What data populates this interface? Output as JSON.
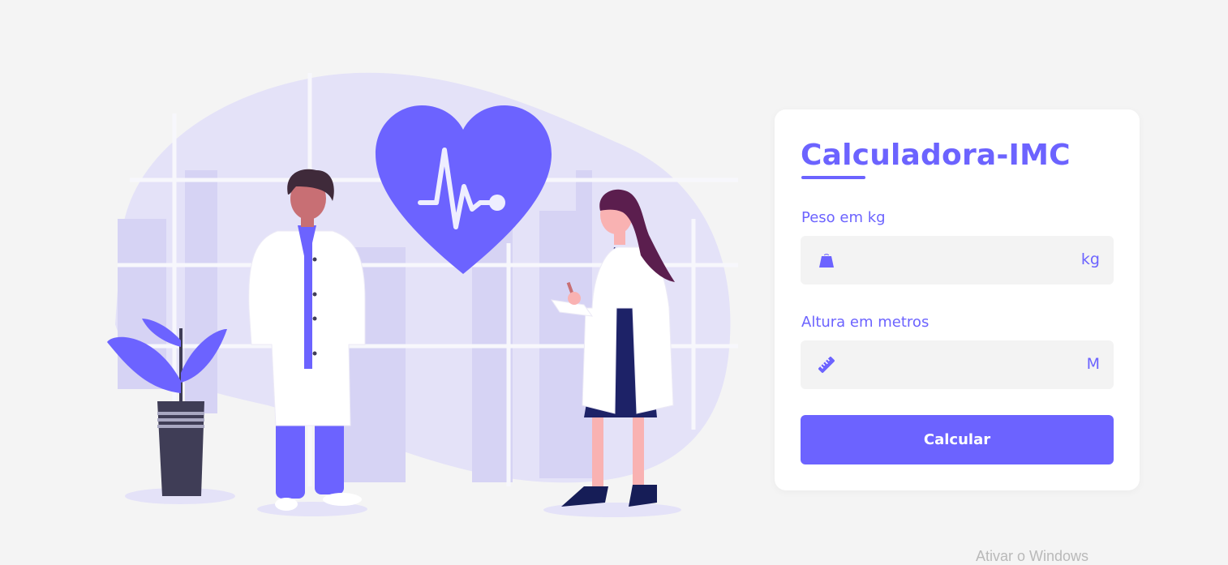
{
  "card": {
    "title": "Calculadora-IMC",
    "weight": {
      "label": "Peso em kg",
      "value": "",
      "unit": "kg",
      "icon": "weight-icon"
    },
    "height": {
      "label": "Altura em metros",
      "value": "",
      "unit": "M",
      "icon": "ruler-icon"
    },
    "button_label": "Calcular"
  },
  "illustration": {
    "icon": "doctors-heart-illustration"
  },
  "watermark": "Ativar o Windows",
  "colors": {
    "accent": "#6c63ff",
    "background": "#f4f4f4",
    "card": "#ffffff",
    "field": "#f3f3f3",
    "blob": "#e4e2f8"
  }
}
